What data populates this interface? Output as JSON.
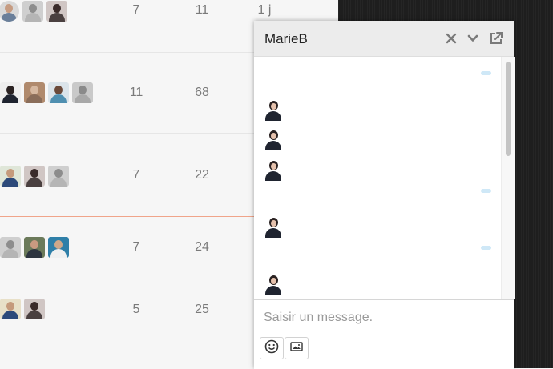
{
  "topics": [
    {
      "replies": "7",
      "views": "11",
      "activity": "1 j"
    },
    {
      "replies": "11",
      "views": "68",
      "activity": ""
    },
    {
      "replies": "7",
      "views": "22",
      "activity": ""
    },
    {
      "replies": "7",
      "views": "24",
      "activity": ""
    },
    {
      "replies": "5",
      "views": "25",
      "activity": ""
    }
  ],
  "chat": {
    "title": "MarieB",
    "close_icon": "close-icon",
    "minimize_icon": "chevron-down-icon",
    "popout_icon": "external-link-icon",
    "composer_placeholder": "Saisir un message.",
    "emoji_icon": "smiley-icon",
    "image_icon": "image-icon"
  },
  "colors": {
    "unread_line": "#f0a48a",
    "outgoing_bubble": "#cfe8f7",
    "header_bg": "#ececec"
  }
}
